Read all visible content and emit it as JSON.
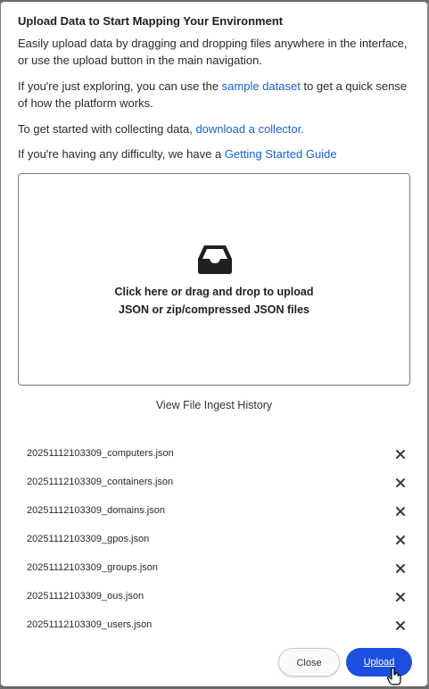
{
  "dialog": {
    "title": "Upload Data to Start Mapping Your Environment",
    "intro": "Easily upload data by dragging and dropping files anywhere in the interface, or use the upload button in the main navigation.",
    "explore_prefix": "If you're just exploring, you can use the ",
    "explore_link": "sample dataset",
    "explore_suffix": " to get a quick sense of how the platform works.",
    "collect_prefix": "To get started with collecting data, ",
    "collect_link": "download a collector.",
    "difficulty_prefix": "If you're having any difficulty, we have a ",
    "difficulty_link": "Getting Started Guide"
  },
  "dropzone": {
    "line1": "Click here or drag and drop to upload",
    "line2": "JSON or zip/compressed JSON files",
    "icon": "inbox-icon"
  },
  "history_link": "View File Ingest History",
  "files": [
    "20251112103309_computers.json",
    "20251112103309_containers.json",
    "20251112103309_domains.json",
    "20251112103309_gpos.json",
    "20251112103309_groups.json",
    "20251112103309_ous.json",
    "20251112103309_users.json"
  ],
  "buttons": {
    "close": "Close",
    "upload": "Upload"
  },
  "colors": {
    "link": "#1a5fd6",
    "primary": "#1b4fe0"
  }
}
